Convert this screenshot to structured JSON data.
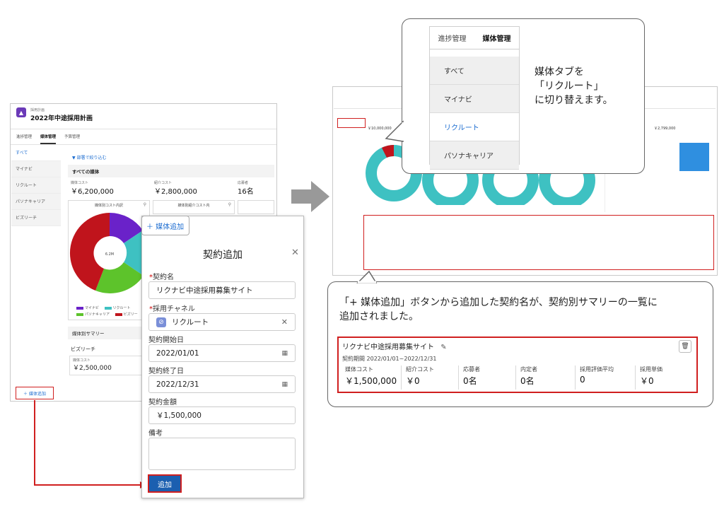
{
  "left_app": {
    "record_type": "採用計画",
    "title": "2022年中途採用計画",
    "tabs": [
      "進捗管理",
      "媒体管理",
      "予算管理"
    ],
    "media_list": [
      "すべて",
      "マイナビ",
      "リクルート",
      "パソナキャリア",
      "ビズリーチ"
    ],
    "filter_link": "部署で絞り込む",
    "all_media_heading": "すべての媒体",
    "metrics": [
      {
        "label": "媒体コスト",
        "value": "￥6,200,000"
      },
      {
        "label": "紹介コスト",
        "value": "￥2,800,000"
      },
      {
        "label": "応募者",
        "value": "16名"
      }
    ],
    "chart_titles": [
      "媒体別コスト内訳",
      "媒体別紹介コスト内"
    ],
    "donut_center": "6.2M",
    "legend": [
      "マイナビ",
      "リクルート",
      "パソナキャリア",
      "ビズリー"
    ],
    "summary_heading": "媒体別サマリー",
    "bizreach_row": {
      "name": "ビズリーチ",
      "cost_label": "媒体コスト",
      "cost_value": "￥2,500,000"
    },
    "add_media_label": "＋ 媒体追加",
    "colors": {
      "purple": "#6a22c9",
      "teal": "#3ec1c2",
      "green": "#5dc32b",
      "red": "#c0141c"
    }
  },
  "modal": {
    "tag_label": "＋ 媒体追加",
    "title": "契約追加",
    "close": "✕",
    "fields": {
      "contract_name": {
        "label": "契約名",
        "value": "リクナビ中途採用募集サイト"
      },
      "channel": {
        "label": "採用チャネル",
        "value": "リクルート"
      },
      "start_date": {
        "label": "契約開始日",
        "value": "2022/01/01"
      },
      "end_date": {
        "label": "契約終了日",
        "value": "2022/12/31"
      },
      "amount": {
        "label": "契約金額",
        "value": "￥1,500,000"
      },
      "notes": {
        "label": "備考",
        "value": ""
      }
    },
    "submit": "追加"
  },
  "callout_tabs": {
    "tabs": [
      "進捗管理",
      "媒体管理"
    ],
    "items": [
      "すべて",
      "マイナビ",
      "リクルート",
      "パソナキャリア"
    ],
    "text": [
      "媒体タブを",
      "「リクルート」",
      "に切り替えます。"
    ]
  },
  "callout_summary": {
    "text": [
      "「+ 媒体追加」ボタンから追加した契約名が、契約別サマリーの一覧に",
      "追加されました。"
    ],
    "card_title": "リクナビ中途採用募集サイト",
    "period": "契約期間 2022/01/01~2022/12/31",
    "cells": [
      {
        "label": "媒体コスト",
        "value": "￥1,500,000"
      },
      {
        "label": "紹介コスト",
        "value": "￥0"
      },
      {
        "label": "応募者",
        "value": "0名"
      },
      {
        "label": "内定者",
        "value": "0名"
      },
      {
        "label": "採用評価平均",
        "value": "0"
      },
      {
        "label": "採用単価",
        "value": "￥0"
      }
    ]
  },
  "right_shot": {
    "sub_cost": "￥10,000,000",
    "right_cost": "￥2,799,000"
  }
}
